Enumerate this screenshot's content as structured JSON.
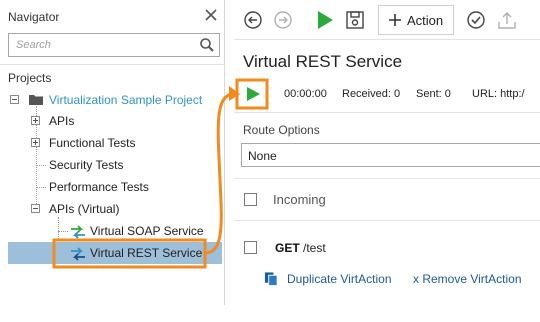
{
  "navigator": {
    "title": "Navigator",
    "search_placeholder": "Search",
    "projects_label": "Projects",
    "tree": {
      "project": "Virtualization Sample Project",
      "apis": "APIs",
      "functional_tests": "Functional Tests",
      "security_tests": "Security Tests",
      "performance_tests": "Performance Tests",
      "apis_virtual": "APIs (Virtual)",
      "virtual_soap": "Virtual SOAP Service",
      "virtual_rest": "Virtual REST Service"
    }
  },
  "toolbar": {
    "action_label": "Action"
  },
  "editor": {
    "title": "Virtual REST Service",
    "run_time": "00:00:00",
    "received": "Received: 0",
    "sent": "Sent: 0",
    "url": "URL: http:/",
    "route_options_label": "Route Options",
    "route_value": "None",
    "incoming_label": "Incoming",
    "get_method": "GET",
    "get_path": "/test",
    "duplicate_label": "Duplicate VirtAction",
    "remove_label": "x Remove VirtAction"
  },
  "colors": {
    "accent": "#2e94c7",
    "run_green": "#2daa3c",
    "callout_orange": "#f28a1e",
    "selection": "#9ebfd9",
    "link": "#1d5a9e"
  }
}
